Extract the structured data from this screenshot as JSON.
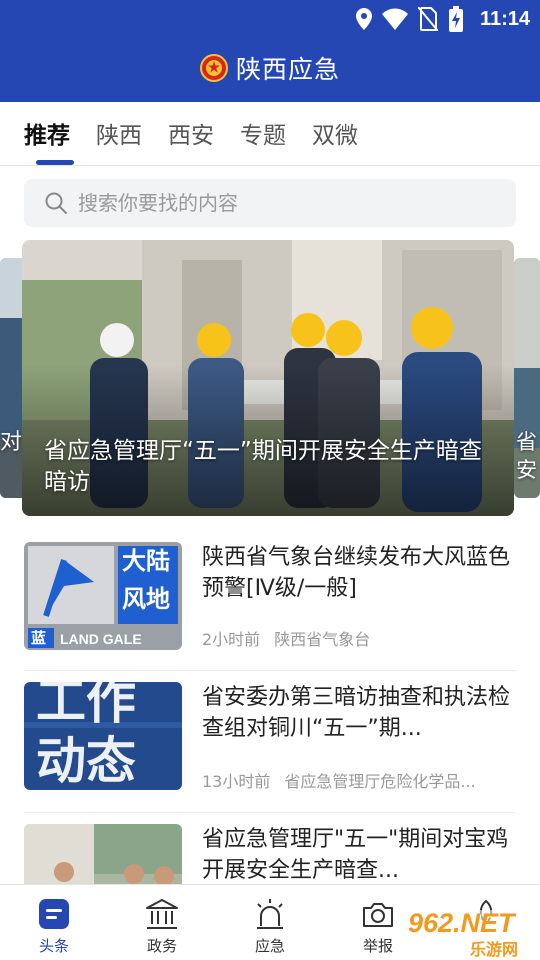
{
  "status_bar": {
    "time": "11:14",
    "icons": [
      "location-icon",
      "wifi-icon",
      "no-sim-icon",
      "battery-charging-icon"
    ]
  },
  "header": {
    "title": "陕西应急",
    "logo": "national-emblem-icon"
  },
  "tabs": [
    {
      "label": "推荐",
      "active": true
    },
    {
      "label": "陕西",
      "active": false
    },
    {
      "label": "西安",
      "active": false
    },
    {
      "label": "专题",
      "active": false
    },
    {
      "label": "双微",
      "active": false
    }
  ],
  "search": {
    "placeholder": "搜索你要找的内容"
  },
  "carousel": {
    "main_caption": "省应急管理厅“五一”期间开展安全生产暗查暗访",
    "left_caption": "对",
    "right_caption": "省安"
  },
  "news": [
    {
      "title": "陕西省气象台继续发布大风蓝色预警[Ⅳ级/一般]",
      "time": "2小时前",
      "source": "陕西省气象台",
      "thumb": {
        "line1": "大陆",
        "line2": "风地",
        "badge": "蓝",
        "caption": "LAND GALE"
      }
    },
    {
      "title": "省安委办第三暗访抽查和执法检查组对铜川“五一”期...",
      "time": "13小时前",
      "source": "省应急管理厅危险化学品...",
      "thumb": {
        "line1": "工作",
        "line2": "动态"
      }
    },
    {
      "title": "省应急管理厅\"五一\"期间对宝鸡开展安全生产暗查...",
      "time": "",
      "source": ""
    }
  ],
  "bottom_nav": [
    {
      "label": "头条",
      "icon": "news-icon",
      "active": true
    },
    {
      "label": "政务",
      "icon": "government-building-icon",
      "active": false
    },
    {
      "label": "应急",
      "icon": "alarm-light-icon",
      "active": false
    },
    {
      "label": "举报",
      "icon": "camera-icon",
      "active": false
    },
    {
      "label": "",
      "icon": "leaf-icon",
      "active": false
    }
  ],
  "watermark": {
    "line1": "962.NET",
    "line2": "乐游网"
  },
  "colors": {
    "brand_blue": "#2447b3",
    "tab_indicator": "#2447b3",
    "text_primary": "#222222",
    "text_meta": "#999999"
  }
}
